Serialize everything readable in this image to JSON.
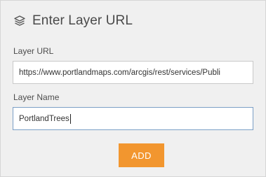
{
  "dialog": {
    "title": "Enter Layer URL",
    "icon": "layers-icon"
  },
  "form": {
    "url_label": "Layer URL",
    "url_value": "https://www.portlandmaps.com/arcgis/rest/services/Publi",
    "name_label": "Layer Name",
    "name_value": "PortlandTrees"
  },
  "actions": {
    "add_label": "ADD"
  },
  "colors": {
    "accent": "#f2962f",
    "panel_bg": "#f0f0f0",
    "focus_border": "#7b9fc6"
  }
}
